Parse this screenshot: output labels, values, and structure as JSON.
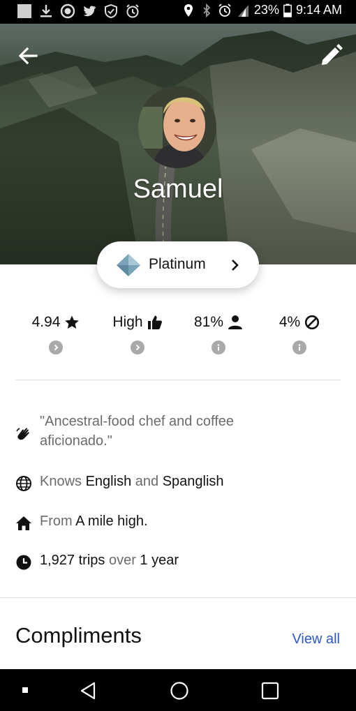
{
  "status_bar": {
    "battery": "23%",
    "time": "9:14 AM",
    "icons": [
      "notification-icon",
      "download-icon",
      "sync-icon",
      "twitter-icon",
      "shield-icon",
      "alarm-icon",
      "location-icon",
      "bluetooth-icon",
      "alarm-icon",
      "lte-signal-icon",
      "battery-icon"
    ]
  },
  "header": {
    "back_icon": "arrow-left-icon",
    "edit_icon": "pencil-icon",
    "name": "Samuel"
  },
  "tier": {
    "label": "Platinum",
    "icon": "diamond-icon"
  },
  "stats": [
    {
      "value": "4.94",
      "icon": "star-icon",
      "detail_icon": "chevron-circle-icon"
    },
    {
      "value": "High",
      "icon": "thumbs-up-icon",
      "detail_icon": "chevron-circle-icon"
    },
    {
      "value": "81%",
      "icon": "person-icon",
      "detail_icon": "info-circle-icon"
    },
    {
      "value": "4%",
      "icon": "block-icon",
      "detail_icon": "info-circle-icon"
    }
  ],
  "about": {
    "bio": "\"Ancestral-food chef and coffee",
    "bio_line2": "aficionado.\"",
    "languages_prefix": "Knows",
    "language_1": "English",
    "languages_and": "and",
    "language_2": "Spanglish",
    "from_prefix": "From",
    "from_value": "A mile high.",
    "trips_value": "1,927 trips",
    "trips_over": "over",
    "trips_duration": "1 year"
  },
  "compliments": {
    "title": "Compliments",
    "view_all": "View all"
  },
  "colors": {
    "link": "#2b57c7",
    "tier_gem": "#6f98ad",
    "muted_text": "#6b6b6b"
  }
}
